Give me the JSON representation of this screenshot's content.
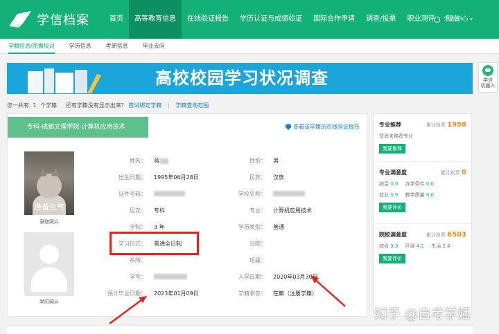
{
  "header": {
    "logo_text": "学信档案",
    "nav": [
      "首页",
      "高等教育信息",
      "在线验证报告",
      "学历认证与成绩验证",
      "国际合作申请",
      "调查/投票",
      "职业测评",
      "就业"
    ],
    "nav_active": 1,
    "user_menu": "个人中心"
  },
  "subnav": {
    "items": [
      "学籍信息/图像校对",
      "学历信息",
      "考研信息",
      "毕业去向"
    ],
    "active": 0
  },
  "banner": {
    "title": "高校校园学习状况调查"
  },
  "robot": {
    "label": "学信\n机器人"
  },
  "info_line": {
    "prefix": "您一共有",
    "count": "1",
    "unit": "个学籍",
    "question": "还有学籍没有显示出来？",
    "link1": "尝试绑定学籍",
    "divider": "|",
    "link2": "学籍查询范围"
  },
  "card": {
    "tab_title": "专科-成都文理学院-计算机应用技术",
    "verify_link": "查看该学籍的在线验证报告",
    "photo1_caption": "准备生气",
    "photo1_label": "录取照片",
    "photo2_label": "学历照片",
    "fields_left": [
      {
        "label": "姓名：",
        "value": "蒋"
      },
      {
        "label": "出生日期：",
        "value": "1995年06月28日"
      },
      {
        "label": "证件号码：",
        "value": ""
      },
      {
        "label": "层次：",
        "value": "专科"
      },
      {
        "label": "学制：",
        "value": "3 年"
      },
      {
        "label": "学习形式：",
        "value": "普通全日制"
      },
      {
        "label": "系所：",
        "value": ""
      },
      {
        "label": "学号：",
        "value": ""
      },
      {
        "label": "预计毕业日期：",
        "value": "2023年01月09日"
      }
    ],
    "fields_right": [
      {
        "label": "性别：",
        "value": "男"
      },
      {
        "label": "民族：",
        "value": "汉族"
      },
      {
        "label": "学校名称：",
        "value": ""
      },
      {
        "label": "专业：",
        "value": "计算机应用技术"
      },
      {
        "label": "学历类别：",
        "value": "普通"
      },
      {
        "label": "分院：",
        "value": ""
      },
      {
        "label": "班级：",
        "value": ""
      },
      {
        "label": "入学日期：",
        "value": "2020年03月30日"
      },
      {
        "label": "学籍状态：",
        "value": "在籍（注册学籍）"
      }
    ]
  },
  "side": {
    "sections": [
      {
        "title": "专业推荐",
        "count_label": "累计投票",
        "count": "1958",
        "lines": [
          [
            {
              "k": "您尚未推荐专业",
              "v": ""
            }
          ]
        ],
        "button": "我要推荐"
      },
      {
        "title": "专业满意度",
        "count_label": "累计投票",
        "count": "0",
        "lines": [
          [
            {
              "k": "综合",
              "v": "0.0"
            },
            {
              "k": "办学条件",
              "v": "0.0"
            }
          ],
          [
            {
              "k": "就业",
              "v": "0.0"
            },
            {
              "k": "教学质量",
              "v": "0.0"
            }
          ]
        ],
        "button": "我要评价"
      },
      {
        "title": "院校满意度",
        "count_label": "累计投票",
        "count": "6503",
        "lines": [
          [
            {
              "k": "综合",
              "v": "3.3"
            },
            {
              "k": "环境",
              "v": "4.1"
            },
            {
              "k": "生活",
              "v": "2.4"
            }
          ]
        ],
        "button": "我要评价"
      }
    ]
  },
  "watermark": "知乎 @自考学姐",
  "colors": {
    "brand": "#13b07a",
    "banner": "#1ba5d8",
    "highlight": "#e8231d",
    "link": "#1b7ed6",
    "count": "#f08c1c"
  }
}
